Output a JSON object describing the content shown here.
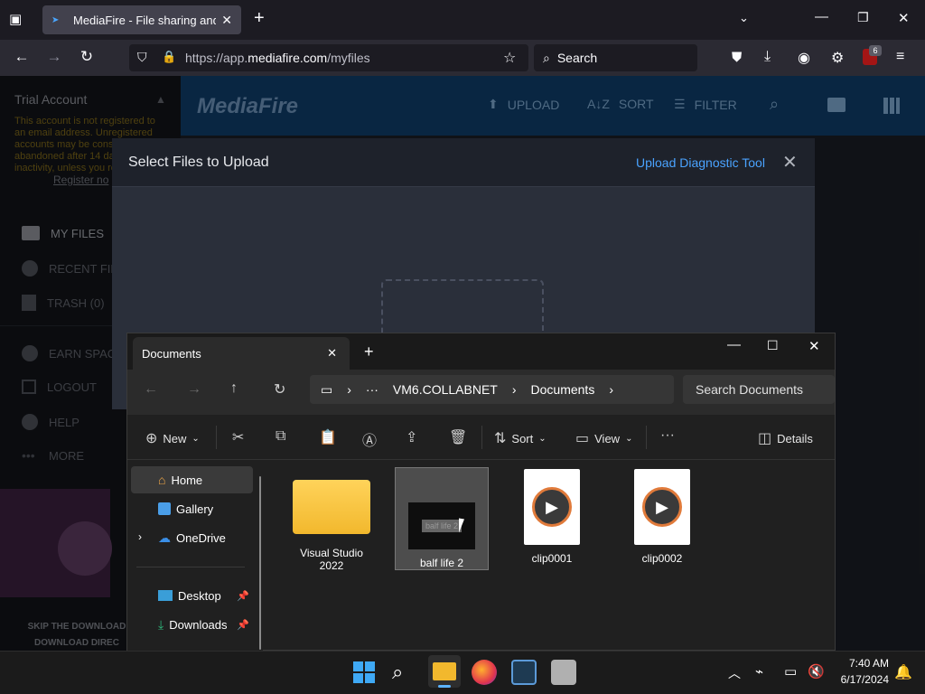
{
  "browser": {
    "tab_title": "MediaFire - File sharing and sto",
    "url_prefix": "https://app.",
    "url_domain": "mediafire.com",
    "url_path": "/myfiles",
    "search_placeholder": "Search",
    "extension_badge": "6"
  },
  "mediafire": {
    "account_title": "Trial Account",
    "account_notice": "This account is not registered to an email address. Unregistered accounts may be considered abandoned after 14 days of inactivity, unless you register.",
    "register_link": "Register no",
    "logo": "MediaFire",
    "header_buttons": [
      "UPLOAD",
      "SORT",
      "FILTER"
    ],
    "sidebar_items": [
      "MY FILES",
      "RECENT FIL",
      "TRASH (0)",
      "EARN SPAC",
      "LOGOUT",
      "HELP",
      "MORE"
    ],
    "skip_line1": "SKIP THE DOWNLOAD",
    "skip_line2": "DOWNLOAD DIREC"
  },
  "upload_modal": {
    "title": "Select Files to Upload",
    "diagnostic_link": "Upload Diagnostic Tool"
  },
  "explorer": {
    "tab_title": "Documents",
    "breadcrumb": [
      "VM6.COLLABNET",
      "Documents"
    ],
    "search_placeholder": "Search Documents",
    "toolbar": {
      "new": "New",
      "sort": "Sort",
      "view": "View",
      "details": "Details"
    },
    "nav": [
      {
        "label": "Home",
        "icon": "home-icon"
      },
      {
        "label": "Gallery",
        "icon": "gallery-icon"
      },
      {
        "label": "OneDrive",
        "icon": "cloud-icon"
      },
      {
        "label": "Desktop",
        "icon": "desktop-icon"
      },
      {
        "label": "Downloads",
        "icon": "download-icon"
      }
    ],
    "files": [
      {
        "name": "Visual Studio 2022",
        "type": "folder"
      },
      {
        "name": "balf life 2",
        "type": "video-thumb",
        "thumb_text": "balf life 2"
      },
      {
        "name": "clip0001",
        "type": "video"
      },
      {
        "name": "clip0002",
        "type": "video"
      }
    ]
  },
  "taskbar": {
    "time": "7:40 AM",
    "date": "6/17/2024"
  }
}
